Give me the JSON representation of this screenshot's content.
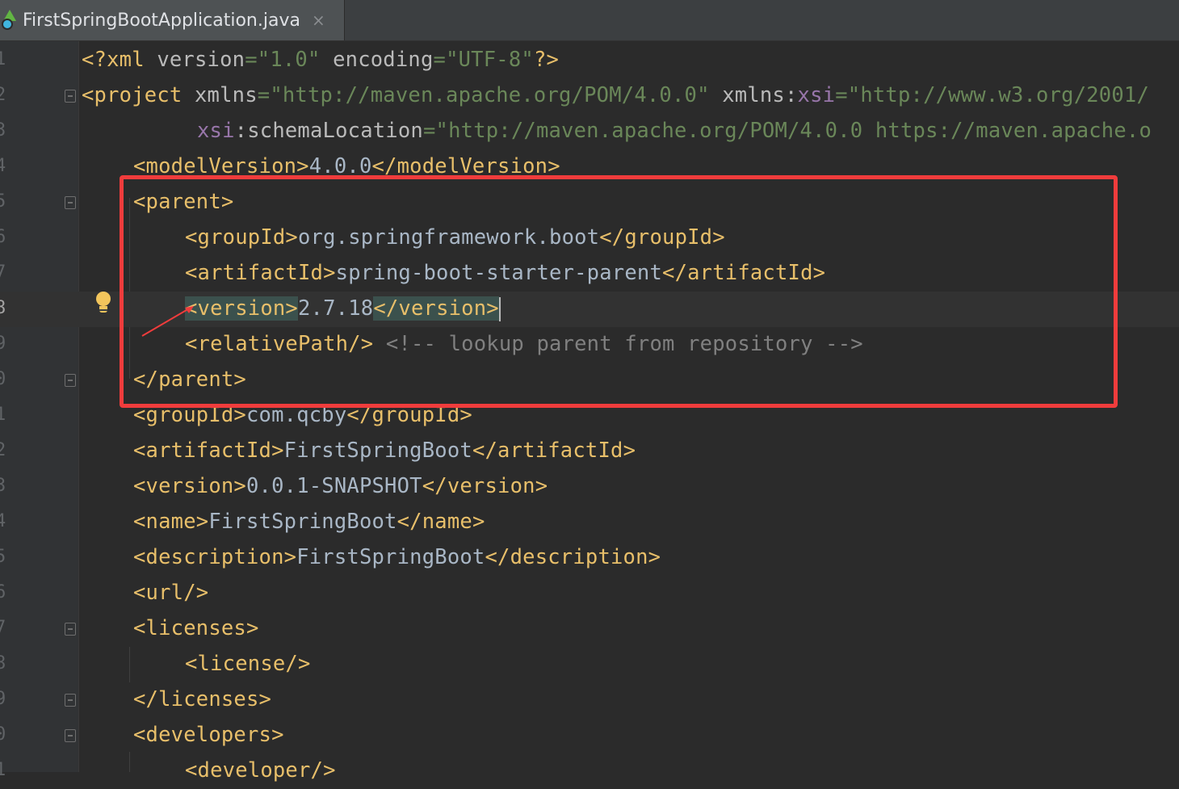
{
  "tab": {
    "title": "FirstSpringBootApplication.java",
    "close": "×"
  },
  "lines": {
    "l1": {
      "num": "1",
      "p1": "<?xml ",
      "p2": "version",
      "p3": "=",
      "p4": "\"1.0\"",
      "p5": " encoding",
      "p6": "=",
      "p7": "\"UTF-8\"",
      "p8": "?>"
    },
    "l2": {
      "num": "2",
      "p1": "<project ",
      "p2": "xmlns",
      "p3": "=",
      "p4": "\"http://maven.apache.org/POM/4.0.0\"",
      "p5": " xmlns:",
      "p6": "xsi",
      "p7": "=",
      "p8": "\"http://www.w3.org/2001/"
    },
    "l3": {
      "num": "3",
      "p1": "xsi",
      "p2": ":schemaLocation",
      "p3": "=",
      "p4": "\"http://maven.apache.org/POM/4.0.0 https://maven.apache.o"
    },
    "l4": {
      "num": "4",
      "p1": "<modelVersion>",
      "p2": "4.0.0",
      "p3": "</modelVersion>"
    },
    "l5": {
      "num": "5",
      "p1": "<parent>"
    },
    "l6": {
      "num": "6",
      "p1": "<groupId>",
      "p2": "org.springframework.boot",
      "p3": "</groupId>"
    },
    "l7": {
      "num": "7",
      "p1": "<artifactId>",
      "p2": "spring-boot-starter-parent",
      "p3": "</artifactId>"
    },
    "l8": {
      "num": "8",
      "p1": "<version>",
      "p2": "2.7.18",
      "p3": "</version>"
    },
    "l9": {
      "num": "9",
      "p1": "<relativePath/>",
      "p2": " <!-- lookup parent from repository -->"
    },
    "l10": {
      "num": "0",
      "p1": "</parent>"
    },
    "l11": {
      "num": "1",
      "p1": "<groupId>",
      "p2": "com.qcby",
      "p3": "</groupId>"
    },
    "l12": {
      "num": "2",
      "p1": "<artifactId>",
      "p2": "FirstSpringBoot",
      "p3": "</artifactId>"
    },
    "l13": {
      "num": "3",
      "p1": "<version>",
      "p2": "0.0.1-SNAPSHOT",
      "p3": "</version>"
    },
    "l14": {
      "num": "4",
      "p1": "<name>",
      "p2": "FirstSpringBoot",
      "p3": "</name>"
    },
    "l15": {
      "num": "5",
      "p1": "<description>",
      "p2": "FirstSpringBoot",
      "p3": "</description>"
    },
    "l16": {
      "num": "6",
      "p1": "<url/>"
    },
    "l17": {
      "num": "7",
      "p1": "<licenses>"
    },
    "l18": {
      "num": "8",
      "p1": "<license/>"
    },
    "l19": {
      "num": "9",
      "p1": "</licenses>"
    },
    "l20": {
      "num": "0",
      "p1": "<developers>"
    },
    "l21": {
      "num": "1",
      "p1": "<developer/>"
    }
  },
  "colors": {
    "annotation": "#f03c3c",
    "tag": "#e8bf6a",
    "string": "#6a8759",
    "comment": "#808080"
  }
}
